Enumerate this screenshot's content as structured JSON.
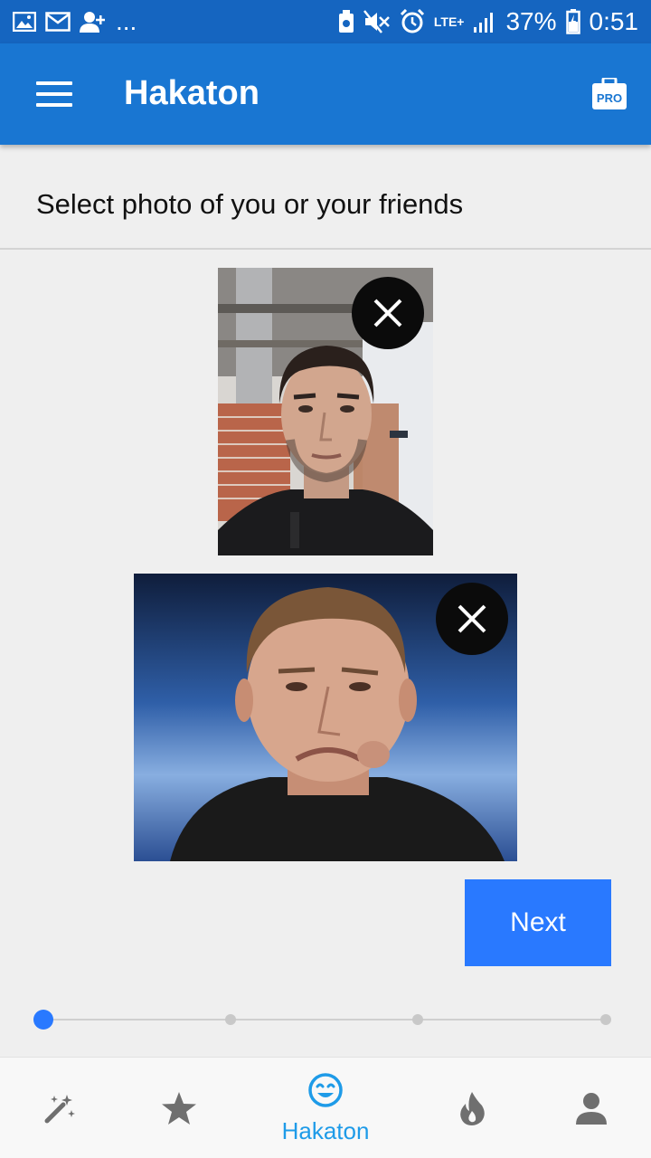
{
  "status_bar": {
    "overflow": "...",
    "network": "LTE+",
    "battery": "37%",
    "time": "0:51"
  },
  "app_bar": {
    "title": "Hakaton",
    "pro_badge": "PRO"
  },
  "instruction": "Select photo of you or your friends",
  "photos": [
    {
      "subject": "man in black hoodie",
      "remove_icon": "close-icon"
    },
    {
      "subject": "man in black t-shirt",
      "remove_icon": "close-icon"
    }
  ],
  "next_label": "Next",
  "stepper": {
    "total_steps": 4,
    "current_step": 1
  },
  "bottom_nav": {
    "items": [
      {
        "icon": "magic-wand-icon",
        "label": ""
      },
      {
        "icon": "star-icon",
        "label": ""
      },
      {
        "icon": "smiley-icon",
        "label": "Hakaton",
        "active": true
      },
      {
        "icon": "flame-icon",
        "label": ""
      },
      {
        "icon": "person-icon",
        "label": ""
      }
    ]
  },
  "colors": {
    "status_bar": "#1565c0",
    "app_bar": "#1976d2",
    "accent": "#2979ff",
    "nav_active": "#1e9be8",
    "nav_inactive": "#6f6f6f"
  }
}
